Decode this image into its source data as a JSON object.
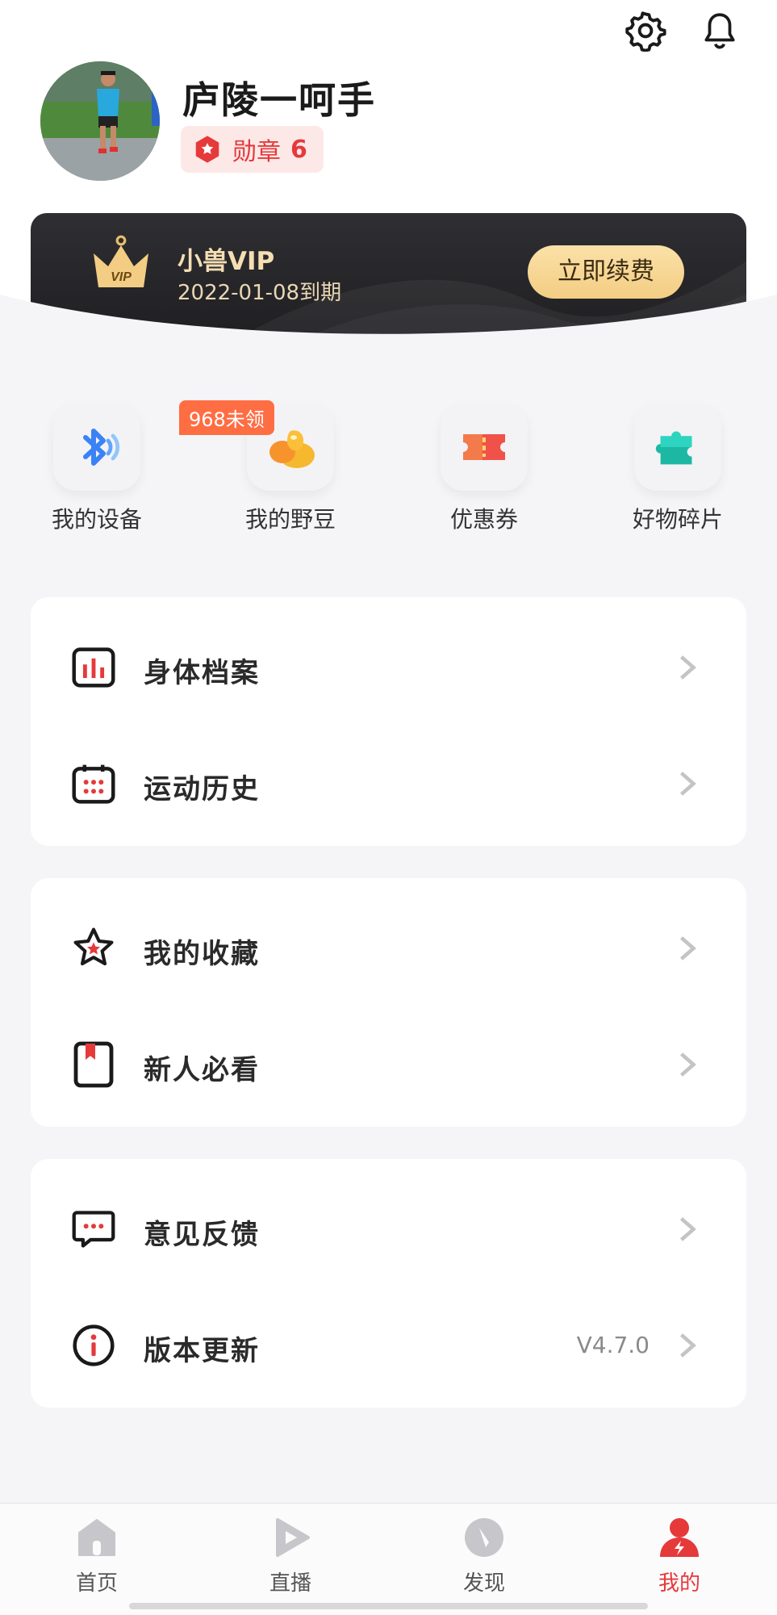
{
  "header": {
    "username": "庐陵一呵手",
    "badge_label": "勋章",
    "badge_count": "6"
  },
  "vip": {
    "title": "小兽VIP",
    "expiry": "2022-01-08到期",
    "renew_label": "立即续费"
  },
  "quick": [
    {
      "label": "我的设备",
      "icon": "bluetooth-icon"
    },
    {
      "label": "我的野豆",
      "icon": "beans-icon",
      "tag": "968未领"
    },
    {
      "label": "优惠券",
      "icon": "coupon-icon"
    },
    {
      "label": "好物碎片",
      "icon": "puzzle-icon"
    }
  ],
  "menu_groups": [
    {
      "items": [
        {
          "label": "身体档案",
          "icon": "chart-icon"
        },
        {
          "label": "运动历史",
          "icon": "calendar-icon"
        }
      ]
    },
    {
      "items": [
        {
          "label": "我的收藏",
          "icon": "star-icon"
        },
        {
          "label": "新人必看",
          "icon": "bookmark-icon"
        }
      ]
    },
    {
      "items": [
        {
          "label": "意见反馈",
          "icon": "message-icon"
        },
        {
          "label": "版本更新",
          "icon": "info-icon",
          "value": "V4.7.0"
        }
      ]
    }
  ],
  "tabs": [
    {
      "label": "首页",
      "icon": "home-icon"
    },
    {
      "label": "直播",
      "icon": "play-icon"
    },
    {
      "label": "发现",
      "icon": "compass-icon"
    },
    {
      "label": "我的",
      "icon": "profile-icon",
      "active": true
    }
  ],
  "colors": {
    "accent": "#e6393a",
    "vip_gold": "#f3cd83",
    "vip_bg": "#2a2a2e",
    "tag_orange": "#ff6d43"
  }
}
